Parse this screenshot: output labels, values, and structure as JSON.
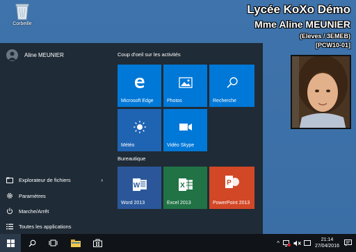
{
  "desktop": {
    "recycle_bin_label": "Corbeille",
    "school": "Lycée KoXo Démo",
    "teacher": "Mme Aline MEUNIER",
    "group": "(Eleves / 3EMEB)",
    "machine": "[PCW10-01]"
  },
  "start_menu": {
    "user_name": "Aline MEUNIER",
    "group_label": "Coup d'oeil sur les activités",
    "group2_label": "Bureautique",
    "items": [
      {
        "label": "Explorateur de fichiers",
        "icon": "folder-icon"
      },
      {
        "label": "Paramètres",
        "icon": "gear-icon"
      },
      {
        "label": "Marche/Arrêt",
        "icon": "power-icon"
      },
      {
        "label": "Toutes les applications",
        "icon": "list-icon"
      }
    ],
    "tiles": [
      {
        "label": "Microsoft Edge",
        "icon": "edge-icon"
      },
      {
        "label": "Photos",
        "icon": "photos-icon"
      },
      {
        "label": "Recherche",
        "icon": "search-icon"
      },
      {
        "label": "Météo",
        "icon": "weather-icon"
      },
      {
        "label": "Vidéo Skype",
        "icon": "video-icon"
      },
      {
        "label": "Word 2013",
        "icon": "word-icon"
      },
      {
        "label": "Excel 2013",
        "icon": "excel-icon"
      },
      {
        "label": "PowerPoint 2013",
        "icon": "powerpoint-icon"
      }
    ]
  },
  "taskbar": {
    "time": "21:14",
    "date": "27/04/2016"
  }
}
